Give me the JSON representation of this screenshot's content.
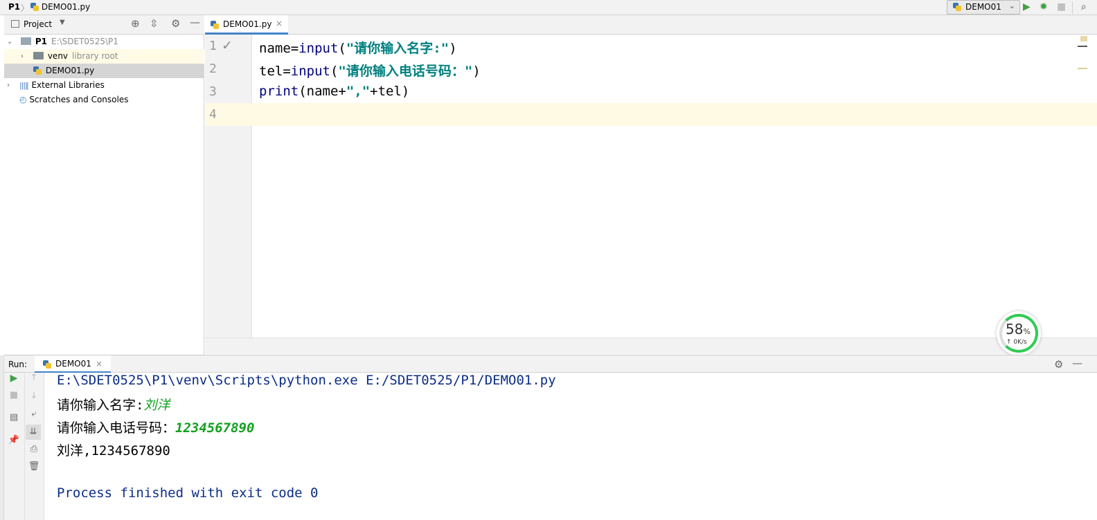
{
  "breadcrumb": {
    "project": "P1",
    "separator": "〉",
    "file": "DEMO01.py"
  },
  "toolbar": {
    "run_config": "DEMO01",
    "run_icon": "play-icon",
    "debug_icon": "bug-icon",
    "stop_icon": "stop-icon",
    "search_icon": "search-icon"
  },
  "project_panel": {
    "title": "Project",
    "tree": [
      {
        "name": "P1",
        "extra": "E:\\SDET0525\\P1"
      },
      {
        "name": "venv",
        "extra": "library root"
      },
      {
        "name": "DEMO01.py",
        "extra": ""
      },
      {
        "name": "External Libraries",
        "extra": ""
      },
      {
        "name": "Scratches and Consoles",
        "extra": ""
      }
    ]
  },
  "editor": {
    "tab_label": "DEMO01.py",
    "tab_close": "×",
    "line_numbers": [
      "1",
      "2",
      "3",
      "4"
    ],
    "checkmark": "✓",
    "code": {
      "l1": {
        "a": "name=",
        "fn": "input",
        "b": "(",
        "str": "\"请你输入名字:\"",
        "c": ")"
      },
      "l2": {
        "a": "tel=",
        "fn": "input",
        "b": "(",
        "str": "\"请你输入电话号码：\"",
        "c": ")"
      },
      "l3": {
        "fn": "print",
        "a": "(name+",
        "str": "\",\"",
        "b": "+tel)"
      }
    }
  },
  "run_panel": {
    "label": "Run:",
    "tab_label": "DEMO01",
    "tab_close": "×",
    "console": {
      "cmd": "E:\\SDET0525\\P1\\venv\\Scripts\\python.exe E:/SDET0525/P1/DEMO01.py",
      "prompt1": "请你输入名字:",
      "input1": "刘洋",
      "prompt2": "请你输入电话号码：",
      "input2": "1234567890",
      "output": "刘洋,1234567890",
      "finished": "Process finished with exit code 0"
    }
  },
  "speed_widget": {
    "percent": "58",
    "percent_unit": "%",
    "rate": "↑ 0K/s"
  },
  "colors": {
    "accent": "#4083c9",
    "current_line": "#fffae3",
    "progress": "#2ecc52"
  }
}
